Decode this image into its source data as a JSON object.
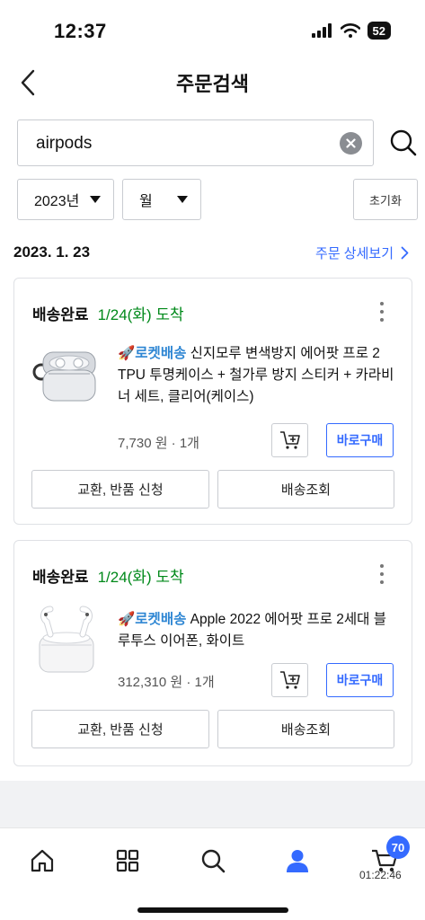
{
  "status_bar": {
    "time": "12:37",
    "battery": "52"
  },
  "header": {
    "title": "주문검색"
  },
  "search": {
    "value": "airpods"
  },
  "filters": {
    "year": "2023년",
    "month": "월",
    "reset_label": "초기화"
  },
  "order_group": {
    "date": "2023. 1. 23",
    "detail_link": "주문 상세보기"
  },
  "orders": [
    {
      "status": "배송완료",
      "eta": "1/24(화) 도착",
      "rocket": "🚀로켓배송",
      "title": " 신지모루 변색방지 에어팟 프로 2 TPU 투명케이스 + 철가루 방지 스티커 + 카라비너 세트, 클리어(케이스)",
      "price": "7,730 원 · 1개",
      "buy_label": "바로구매",
      "exchange_label": "교환, 반품 신청",
      "tracking_label": "배송조회"
    },
    {
      "status": "배송완료",
      "eta": "1/24(화) 도착",
      "rocket": "🚀로켓배송",
      "title": " Apple 2022 에어팟 프로 2세대 블루투스 이어폰, 화이트",
      "price": "312,310 원 · 1개",
      "buy_label": "바로구매",
      "exchange_label": "교환, 반품 신청",
      "tracking_label": "배송조회"
    }
  ],
  "tab_bar": {
    "items": [
      "home-icon",
      "category-icon",
      "search-icon",
      "my-page-icon",
      "cart-icon"
    ],
    "active": "my-page-icon",
    "cart_count": "70",
    "cart_timer": "01:22:46",
    "active_color": "#346aff"
  }
}
